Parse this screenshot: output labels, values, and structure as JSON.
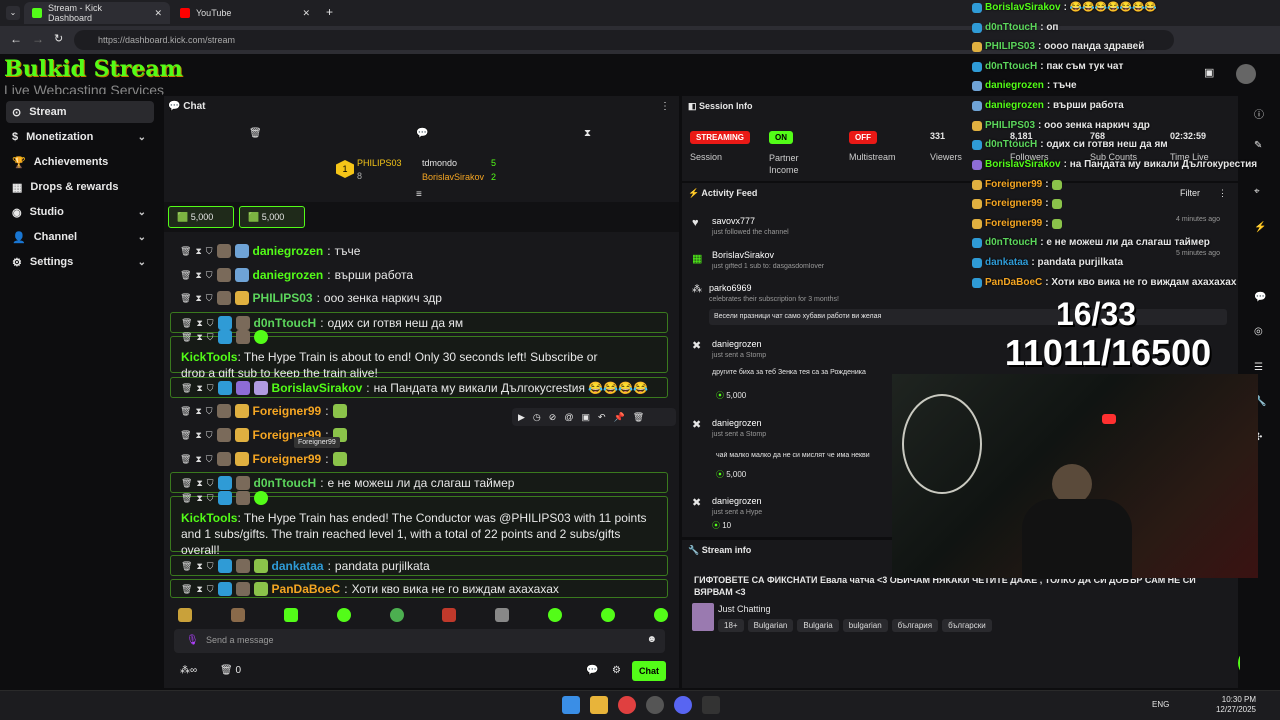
{
  "browser": {
    "tabs": [
      {
        "title": "Stream - Kick Dashboard"
      },
      {
        "title": "YouTube"
      }
    ],
    "url": "https://dashboard.kick.com/stream"
  },
  "brand": {
    "logo_text": "Bulkid Stream",
    "logo_sub": "Live Webcasting Services",
    "accent": "#53fc18"
  },
  "sidebar": {
    "items": [
      {
        "label": "Stream"
      },
      {
        "label": "Monetization"
      },
      {
        "label": "Achievements"
      },
      {
        "label": "Drops & rewards"
      },
      {
        "label": "Studio"
      },
      {
        "label": "Channel"
      },
      {
        "label": "Settings"
      }
    ]
  },
  "chat": {
    "title": "Chat",
    "leaderboard": {
      "rank1": "1",
      "user1": "PHILIPS03",
      "user1_score": "8",
      "user2": "tdmondo",
      "user2_score": "5",
      "user3": "BorislavSirakov",
      "user3_score": "2"
    },
    "pinned": [
      "5,000",
      "5,000"
    ],
    "messages": [
      {
        "user": "daniegrozen",
        "color": "#53fc18",
        "text": "тъче"
      },
      {
        "user": "daniegrozen",
        "color": "#53fc18",
        "text": "върши работа"
      },
      {
        "user": "PHILIPS03",
        "color": "#5cd65c",
        "text": "ооо зенка наркич здр"
      },
      {
        "user": "d0nTtoucH",
        "color": "#5cd65c",
        "text": "одих си готвя неш да ям"
      },
      {
        "user": "KickTools",
        "color": "#53fc18",
        "text": "The Hype Train is about to end! Only 30 seconds left! Subscribe or drop a gift sub to keep the train alive!"
      },
      {
        "user": "BorislavSirakov",
        "color": "#53fc18",
        "text": "на Пандата му викали Дългокуcrestия 😂😂😂😂"
      },
      {
        "user": "Foreigner99",
        "color": "#f5a623",
        "text": ""
      },
      {
        "user": "Foreigner99",
        "color": "#f5a623",
        "text": ""
      },
      {
        "user": "Foreigner99",
        "color": "#f5a623",
        "text": ""
      },
      {
        "user": "d0nTtoucH",
        "color": "#5cd65c",
        "text": "е не можеш ли да слагаш таймер"
      },
      {
        "user": "KickTools",
        "color": "#53fc18",
        "text": "The Hype Train has ended! The Conductor was @PHILIPS03 with 11 points and 1 subs/gifts. The train reached level 1, with a total of 22 points and 2 subs/gifts overall!"
      },
      {
        "user": "dankataa",
        "color": "#2f9bd6",
        "text": "pandata purjilkata"
      },
      {
        "user": "PanDaBoeC",
        "color": "#f5a623",
        "text": "Хоти кво вика не го виждам ахахахах"
      }
    ],
    "tooltip": "Foreigner99",
    "input_placeholder": "Send a message",
    "viewer_count": "0",
    "send_label": "Chat"
  },
  "session": {
    "title": "Session Info",
    "cells": [
      {
        "value": "STREAMING",
        "label": "Session",
        "color": "#e91916"
      },
      {
        "value": "ON",
        "label": "Partner Income",
        "color": "#53fc18"
      },
      {
        "value": "OFF",
        "label": "Multistream",
        "color": "#e91916"
      },
      {
        "value": "331",
        "label": "Viewers"
      },
      {
        "value": "8,181",
        "label": "Followers"
      },
      {
        "value": "768",
        "label": "Sub Counts"
      },
      {
        "value": "02:32:59",
        "label": "Time Live"
      }
    ]
  },
  "activity": {
    "title": "Activity Feed",
    "filter": "Filter",
    "items": [
      {
        "user": "savovx777",
        "sub": "just followed the channel",
        "time": "4 minutes ago"
      },
      {
        "user": "BorislavSirakov",
        "sub": "just gifted 1 sub to: dasgasdomlover",
        "time": "5 minutes ago"
      },
      {
        "user": "parko6969",
        "sub": "celebrates their subscription for 3 months!",
        "note": "Весели празници чат само хубави работи ви желая"
      },
      {
        "user": "daniegrozen",
        "sub": "just sent a Stomp",
        "note": "другите биха за теб Зенка тея са за Рожденика",
        "amount": "5,000"
      },
      {
        "user": "daniegrozen",
        "sub": "just sent a Stomp",
        "note": "чай малко малко да не си мислят че има некви",
        "amount": "5,000"
      },
      {
        "user": "daniegrozen",
        "sub": "just sent a Hype",
        "amount": "10"
      }
    ]
  },
  "stream_info": {
    "title": "Stream info",
    "stream_title": "ГИФТОВЕТЕ СА ФИКСНАТИ Евала чатча <3 ОБИЧАМ НЯКАКИ ЧЕТИТЕ ДАЖЕ , ТОЛКО ДА СИ ДОБЪР САМ НЕ СИ ВЯРВАМ <3",
    "category": "Just Chatting",
    "tags": [
      "18+",
      "Bulgarian",
      "Bulgaria",
      "bulgarian",
      "българия",
      "български"
    ]
  },
  "overlay": {
    "chat": [
      {
        "user": "BorislavSirakov",
        "color": "#53fc18",
        "text": ": 😂😂😂😂😂😂😂"
      },
      {
        "user": "d0nTtoucH",
        "color": "#5cd65c",
        "text": ": оп"
      },
      {
        "user": "PHILIPS03",
        "color": "#5cd65c",
        "text": ": оооо панда здравей"
      },
      {
        "user": "d0nTtoucH",
        "color": "#5cd65c",
        "text": ": пак съм тук чат"
      },
      {
        "user": "daniegrozen",
        "color": "#53fc18",
        "text": ": тъче"
      },
      {
        "user": "daniegrozen",
        "color": "#53fc18",
        "text": ": върши работа"
      },
      {
        "user": "PHILIPS03",
        "color": "#5cd65c",
        "text": ": ооо зенка наркич здр"
      },
      {
        "user": "d0nTtoucH",
        "color": "#5cd65c",
        "text": ": одих си готвя неш да ям"
      },
      {
        "user": "BorislavSirakov",
        "color": "#53fc18",
        "text": ": на Пандата му викали Дългокурестия"
      },
      {
        "user": "Foreigner99",
        "color": "#f5a623",
        "text": ":"
      },
      {
        "user": "Foreigner99",
        "color": "#f5a623",
        "text": ":"
      },
      {
        "user": "Foreigner99",
        "color": "#f5a623",
        "text": ":"
      },
      {
        "user": "d0nTtoucH",
        "color": "#5cd65c",
        "text": ": е не можеш ли да слагаш таймер"
      },
      {
        "user": "dankataa",
        "color": "#2f9bd6",
        "text": ": pandata purjilkata"
      },
      {
        "user": "PanDaBoeC",
        "color": "#f5a623",
        "text": ": Хоти кво вика не го виждам ахахахах"
      }
    ],
    "goal1": "16/33",
    "goal2": "11011/16500"
  },
  "taskbar": {
    "lang": "ENG",
    "time": "10:30 PM",
    "date": "12/27/2025"
  }
}
